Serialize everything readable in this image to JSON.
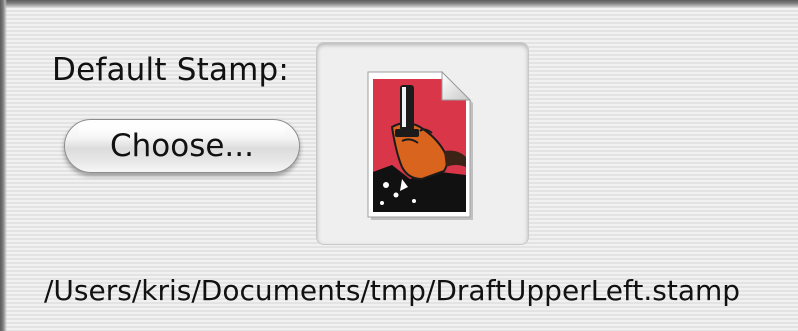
{
  "panel": {
    "default_stamp_label": "Default Stamp:",
    "choose_button_label": "Choose...",
    "stamp_file_path": "/Users/kris/Documents/tmp/DraftUpperLeft.stamp"
  },
  "image_well": {
    "icon": "stamp-document-icon"
  },
  "colors": {
    "stamp_red": "#d9364a",
    "stamp_black": "#111111",
    "hand_orange": "#d9641e"
  }
}
